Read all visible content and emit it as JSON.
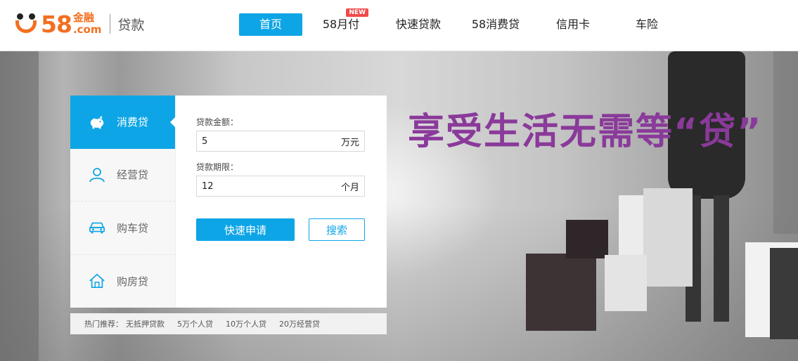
{
  "header": {
    "logo": {
      "brand_number": "58",
      "brand_cn": "金融",
      "brand_domain": ".com",
      "section": "贷款"
    },
    "nav": [
      {
        "label": "首页",
        "active": true
      },
      {
        "label": "58月付",
        "badge": "NEW"
      },
      {
        "label": "快速贷款"
      },
      {
        "label": "58消费贷"
      },
      {
        "label": "信用卡"
      },
      {
        "label": "车险"
      }
    ]
  },
  "banner": {
    "slogan": "享受生活无需等“贷”"
  },
  "loan_tabs": [
    {
      "label": "消费贷",
      "icon": "piggy-bank-icon",
      "active": true
    },
    {
      "label": "经营贷",
      "icon": "person-icon"
    },
    {
      "label": "购车贷",
      "icon": "car-icon"
    },
    {
      "label": "购房贷",
      "icon": "house-icon"
    }
  ],
  "form": {
    "amount_label": "贷款金额：",
    "amount_value": "5",
    "amount_unit": "万元",
    "term_label": "贷款期限：",
    "term_value": "12",
    "term_unit": "个月",
    "apply_label": "快速申请",
    "search_label": "搜索"
  },
  "hot": {
    "label": "热门推荐：",
    "links": [
      "无抵押贷款",
      "5万个人贷",
      "10万个人贷",
      "20万经营贷"
    ]
  },
  "colors": {
    "accent": "#0ea5e6",
    "brand": "#f36f20",
    "slogan": "#8a3a9a",
    "badge": "#f04b4b"
  }
}
